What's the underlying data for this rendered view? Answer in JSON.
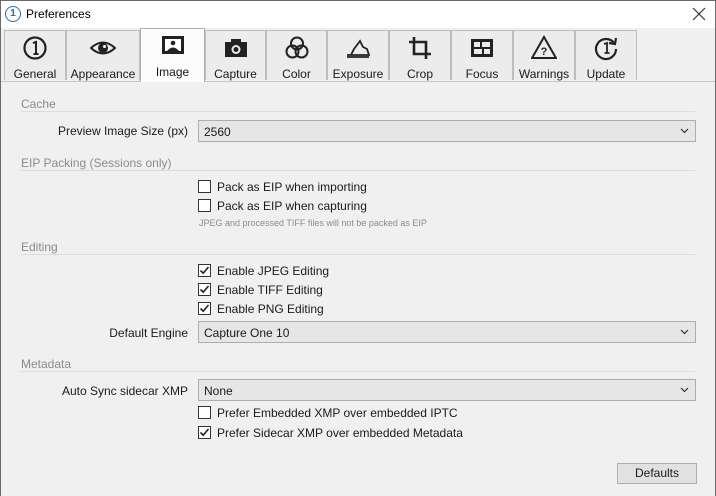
{
  "window": {
    "title": "Preferences",
    "app_icon_glyph": "1"
  },
  "tabs": [
    {
      "label": "General",
      "icon": "capture-one-logo-icon"
    },
    {
      "label": "Appearance",
      "icon": "eye-icon"
    },
    {
      "label": "Image",
      "icon": "image-icon",
      "active": true
    },
    {
      "label": "Capture",
      "icon": "camera-icon"
    },
    {
      "label": "Color",
      "icon": "color-circles-icon"
    },
    {
      "label": "Exposure",
      "icon": "exposure-icon"
    },
    {
      "label": "Crop",
      "icon": "crop-icon"
    },
    {
      "label": "Focus",
      "icon": "focus-grid-icon"
    },
    {
      "label": "Warnings",
      "icon": "warning-triangle-icon"
    },
    {
      "label": "Update",
      "icon": "update-icon"
    }
  ],
  "cache": {
    "heading": "Cache",
    "preview_label": "Preview Image Size (px)",
    "preview_value": "2560"
  },
  "eip": {
    "heading": "EIP Packing (Sessions only)",
    "importing_label": "Pack as EIP when importing",
    "importing_checked": false,
    "capturing_label": "Pack as EIP when capturing",
    "capturing_checked": false,
    "note": "JPEG and processed TIFF files will not be packed as EIP"
  },
  "editing": {
    "heading": "Editing",
    "jpeg_label": "Enable JPEG Editing",
    "jpeg_checked": true,
    "tiff_label": "Enable TIFF Editing",
    "tiff_checked": true,
    "png_label": "Enable PNG Editing",
    "png_checked": true,
    "engine_label": "Default Engine",
    "engine_value": "Capture One 10"
  },
  "metadata": {
    "heading": "Metadata",
    "autosync_label": "Auto Sync sidecar XMP",
    "autosync_value": "None",
    "embedded_label": "Prefer Embedded XMP over embedded IPTC",
    "embedded_checked": false,
    "sidecar_label": "Prefer Sidecar XMP over embedded Metadata",
    "sidecar_checked": true
  },
  "footer": {
    "defaults_label": "Defaults"
  }
}
